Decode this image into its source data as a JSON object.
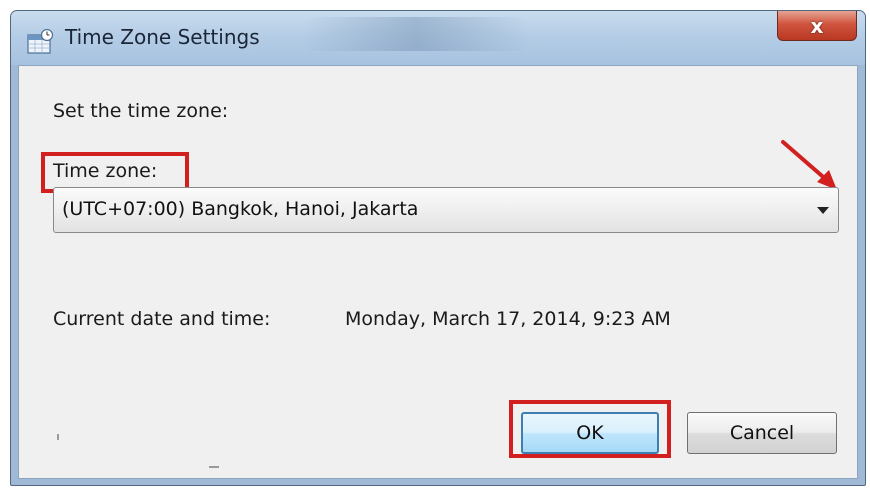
{
  "window": {
    "title": "Time Zone Settings",
    "icon": "clock-calendar-icon",
    "close_icon": "close-icon",
    "close_glyph": "x"
  },
  "content": {
    "set_label": "Set the time zone:",
    "timezone_label": "Time zone:",
    "timezone_selected": "(UTC+07:00) Bangkok, Hanoi, Jakarta",
    "dropdown_icon": "chevron-down-icon",
    "current_label": "Current date and time:",
    "current_value": "Monday, March 17, 2014, 9:23 AM"
  },
  "buttons": {
    "ok_label": "OK",
    "cancel_label": "Cancel"
  },
  "annotations": {
    "highlight_color": "#d1201f",
    "arrow_color": "#d1201f",
    "arrow_icon": "arrow-annotation-icon"
  },
  "colors": {
    "titlebar": "#b5cde6",
    "close_button": "#c94a33",
    "dialog_background": "#f0f0f0",
    "default_button_border": "#3c7fb1"
  }
}
